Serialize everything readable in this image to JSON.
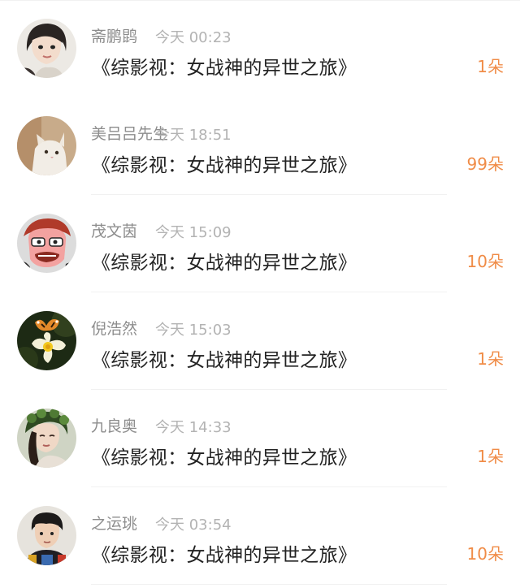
{
  "accent_color": "#f08c47",
  "gifts": [
    {
      "name": "美吕吕先生",
      "time": "今天 18:51",
      "title": "《综影视：女战神的异世之旅》",
      "amount": "99朵",
      "avatar_icon": "cat-avatar-icon"
    },
    {
      "name": "茂文茵",
      "time": "今天 15:09",
      "title": "《综影视：女战神的异世之旅》",
      "amount": "10朵",
      "avatar_icon": "cartoon-avatar-icon"
    },
    {
      "name": "倪浩然",
      "time": "今天 15:03",
      "title": "《综影视：女战神的异世之旅》",
      "amount": "1朵",
      "avatar_icon": "butterfly-flower-avatar-icon"
    },
    {
      "name": "九良奥",
      "time": "今天 14:33",
      "title": "《综影视：女战神的异世之旅》",
      "amount": "1朵",
      "avatar_icon": "woman-portrait-avatar-icon"
    },
    {
      "name": "之运珧",
      "time": "今天 03:54",
      "title": "《综影视：女战神的异世之旅》",
      "amount": "10朵",
      "avatar_icon": "boy-portrait-avatar-icon"
    },
    {
      "name": "斋鹏鹍",
      "time": "今天 00:23",
      "title": "《综影视：女战神的异世之旅》",
      "amount": "1朵",
      "avatar_icon": "girl-portrait-avatar-icon"
    }
  ]
}
